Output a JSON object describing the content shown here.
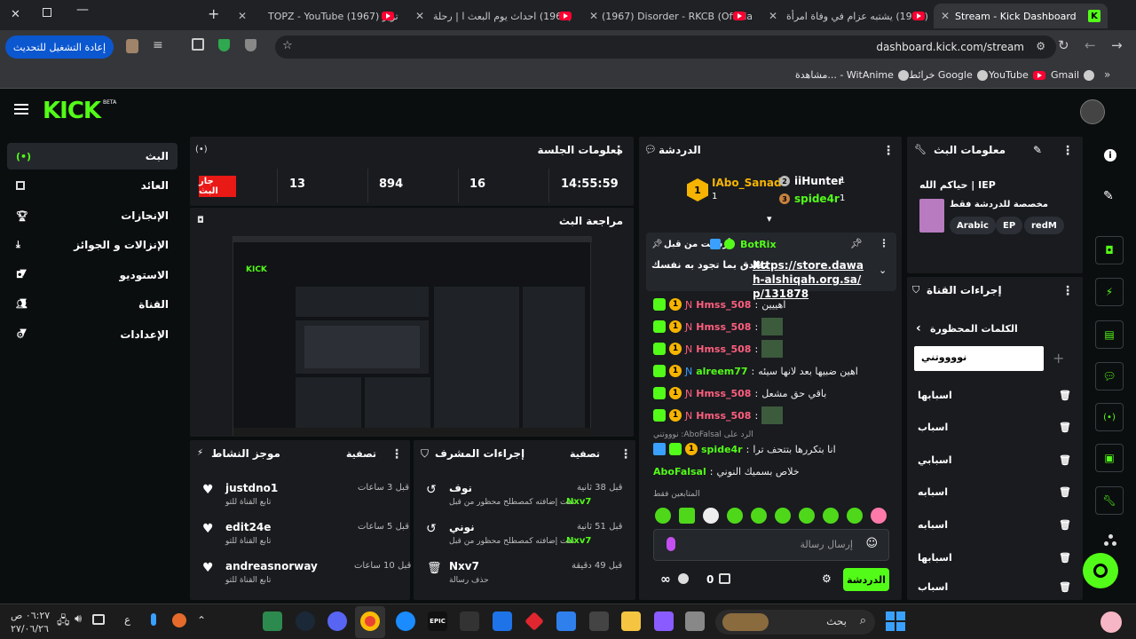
{
  "browser": {
    "tabs": [
      {
        "title": "(1967) يشتبه عزام في وفاة امرأة"
      },
      {
        "title": "(1967) Disorder - RKCB (Official"
      },
      {
        "title": "(1967) احداث يوم البعث ا | رحلة"
      },
      {
        "title": "TOPZ - YouTube تويز (1967)"
      },
      {
        "title": "Stream - Kick Dashboard"
      }
    ],
    "url": "dashboard.kick.com/stream",
    "update_button": "إعادة التشغيل للتحديث",
    "bookmarks": [
      "Gmail",
      "YouTube",
      "خرائط Google",
      "مشاهدة... - WitAnime"
    ]
  },
  "kick": {
    "logo": "KICK",
    "logo_sup": "BETA",
    "sidebar": [
      {
        "label": "البث",
        "icon": "broadcast-icon",
        "active": true
      },
      {
        "label": "العائد",
        "icon": "chart-icon"
      },
      {
        "label": "الإنجازات",
        "icon": "trophy-icon"
      },
      {
        "label": "الإنزالات و الجوائز",
        "icon": "drop-icon"
      },
      {
        "label": "الاستوديو",
        "icon": "camera-icon"
      },
      {
        "label": "القناة",
        "icon": "users-icon"
      },
      {
        "label": "الإعدادات",
        "icon": "gear-icon"
      }
    ],
    "session": {
      "title": "معلومات الجلسة",
      "live_badge": "جار البث",
      "stats": [
        "13",
        "894",
        "16",
        "14:55:59"
      ]
    },
    "preview": {
      "title": "مراجعة البث"
    },
    "activity": {
      "title": "موجز النشاط",
      "filter": "تصفية",
      "items": [
        {
          "user": "justdno1",
          "sub": "تابع القناة للتو",
          "time": "قبل 3 ساعات"
        },
        {
          "user": "edit24e",
          "sub": "تابع القناة للتو",
          "time": "قبل 5 ساعات"
        },
        {
          "user": "andreasnorway",
          "sub": "تابع القناة للتو",
          "time": "قبل 10 ساعات"
        }
      ]
    },
    "modactions": {
      "title": "إجراءات المشرف",
      "filter": "تصفية",
      "items": [
        {
          "word": "نوف",
          "desc": "تمت إضافته كمصطلح محظور من قبل",
          "by": "Nxv7",
          "time": "قبل 38 ثانية"
        },
        {
          "word": "نوني",
          "desc": "تمت إضافته كمصطلح محظور من قبل",
          "by": "Nxv7",
          "time": "قبل 51 ثانية"
        },
        {
          "word": "Nxv7",
          "desc": "حذف رسالة",
          "by": "",
          "time": "قبل 49 دقيقة"
        }
      ]
    },
    "chat": {
      "title": "الدردشة",
      "top": [
        {
          "rank": "1",
          "name": "IAbo_Sanad",
          "count": "1"
        },
        {
          "rank": "2",
          "name": "iiHunter",
          "count": "1"
        },
        {
          "rank": "3",
          "name": "spide4r",
          "count": "1"
        }
      ],
      "pinned_by": "أرسلت من قبل",
      "pinned_user": "BotRix",
      "pinned_msg": "تصدق بما تجود به نفسك",
      "pinned_link": "https://store.dawah-alshiqah.org.sa/p/131878",
      "messages": [
        {
          "user": "Hmss_508",
          "text": "اهييين",
          "color": "r"
        },
        {
          "user": "Hmss_508",
          "text": "",
          "color": "r"
        },
        {
          "user": "Hmss_508",
          "text": "",
          "color": "r"
        },
        {
          "user": "alreem77",
          "text": "اهين ضبيها بعد لانها سيئه",
          "color": "g"
        },
        {
          "user": "Hmss_508",
          "text": "باقي حق مشعل",
          "color": "r"
        },
        {
          "user": "Hmss_508",
          "text": "",
          "color": "r"
        }
      ],
      "reply_note": "الرد على AboFalsal: نوووتني",
      "reply_user": "spide4r",
      "reply_text": "انا بتكررها بتتحف ترا",
      "last_user": "AboFalsal",
      "last_text": "خلاص بسميك النوني",
      "followers_only": "المتابعين فقط",
      "input_placeholder": "إرسال رسالة",
      "send_button": "الدردشة",
      "points": "0"
    },
    "streaminfo": {
      "title": "معلومات البث",
      "stream_title": "حياكم الله | IEP",
      "category": "مخصصة للدردشة فقط",
      "tags": [
        "Arabic",
        "EP",
        "redM"
      ]
    },
    "channel_actions": {
      "title": "إجراءات القناة",
      "sub": "الكلمات المحظورة",
      "input_value": "نووووتني",
      "words": [
        "اسبابها",
        "اسباب",
        "اسبابي",
        "اسبابه",
        "اسبابه",
        "اسبابها",
        "اسباب"
      ]
    }
  },
  "taskbar": {
    "search": "بحث",
    "time": "٠٦:٢٧ ص",
    "date": "٢٧/٠٦/٢٦",
    "lang": "ع"
  }
}
